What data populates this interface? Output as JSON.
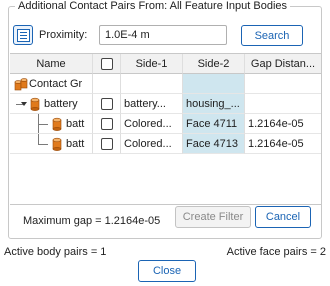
{
  "dialog": {
    "group_title": "Additional Contact Pairs From:  All Feature Input Bodies"
  },
  "proximity": {
    "label": "Proximity:",
    "value": "1.0E-4 m",
    "search_label": "Search",
    "icon": "list-icon"
  },
  "table": {
    "headers": [
      "Name",
      "",
      "Side-1",
      "Side-2",
      "Gap Distan..."
    ],
    "rows": [
      {
        "name": "Contact Gr",
        "checked": false,
        "side1": "",
        "side2": "",
        "gap": "",
        "icon": "contact-group-icon"
      },
      {
        "name": "battery",
        "checked": false,
        "side1": "battery...",
        "side2": "housing_...",
        "gap": "",
        "icon": "body-icon",
        "expanded": true
      },
      {
        "name": "batt",
        "checked": false,
        "side1": "Colored...",
        "side2": "Face 4711",
        "gap": "1.2164e-05",
        "icon": "body-icon"
      },
      {
        "name": "batt",
        "checked": false,
        "side1": "Colored...",
        "side2": "Face 4713",
        "gap": "1.2164e-05",
        "icon": "body-icon"
      }
    ]
  },
  "footer": {
    "max_gap": "Maximum gap = 1.2164e-05",
    "create_filter_label": "Create Filter",
    "cancel_label": "Cancel"
  },
  "summary": {
    "active_body_pairs": "Active body pairs  = 1",
    "active_face_pairs": "Active face pairs  = 2"
  },
  "close_label": "Close",
  "colors": {
    "accent": "#1b64b4",
    "selected_column": "#cfe6ef",
    "body_icon": "#e07a1c"
  }
}
